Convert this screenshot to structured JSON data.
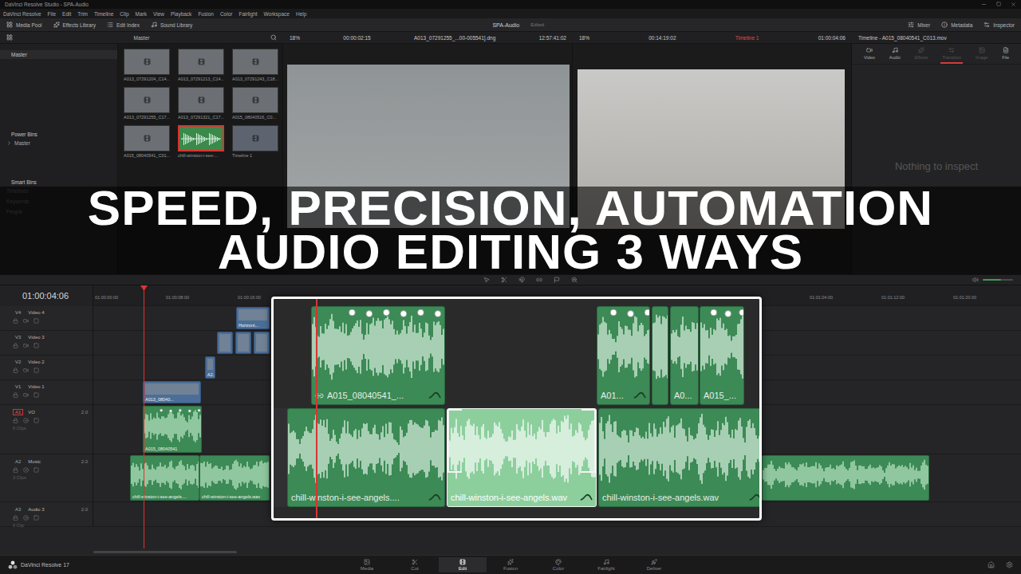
{
  "window": {
    "title": "DaVinci Resolve Studio - SPA-Audio"
  },
  "menu": [
    "DaVinci Resolve",
    "File",
    "Edit",
    "Trim",
    "Timeline",
    "Clip",
    "Mark",
    "View",
    "Playback",
    "Fusion",
    "Color",
    "Fairlight",
    "Workspace",
    "Help"
  ],
  "toolbar": {
    "left": [
      "Media Pool",
      "Effects Library",
      "Edit Index",
      "Sound Library"
    ],
    "project": "SPA-Audio",
    "status": "Edited",
    "right": [
      "Mixer",
      "Metadata",
      "Inspector"
    ]
  },
  "viewer_header": {
    "bin": "Master",
    "source_zoom": "18%",
    "source_duration": "00:00:02:15",
    "source_clip": "A013_07291255_...00-005541].dng",
    "source_timecode": "12:57:41:02",
    "timeline_zoom": "18%",
    "timeline_duration": "00:14:19:02",
    "timeline_name": "Timeline 1",
    "timeline_timecode": "01:00:04:06",
    "inspector_title": "Timeline - A015_08040541_C013.mov"
  },
  "bins": {
    "header": "Master",
    "power_bins": "Power Bins",
    "power_items": [
      {
        "label": "Master",
        "expanded": false
      }
    ],
    "smart_bins": "Smart Bins",
    "smart_items": [
      "Timelines",
      "Keywords",
      "People"
    ]
  },
  "media_pool": [
    {
      "label": "A013_07291204_C14...",
      "kind": "video",
      "selected": false
    },
    {
      "label": "A013_07291213_C14...",
      "kind": "video",
      "selected": false
    },
    {
      "label": "A013_07291243_C18...",
      "kind": "video",
      "selected": false
    },
    {
      "label": "A013_07291255_C17...",
      "kind": "video",
      "selected": false
    },
    {
      "label": "A013_07291321_C17...",
      "kind": "video",
      "selected": false
    },
    {
      "label": "A015_08040516_C0...",
      "kind": "video",
      "selected": false
    },
    {
      "label": "A015_08040541_C01...",
      "kind": "video",
      "selected": false
    },
    {
      "label": "chill-winston-i-see-...",
      "kind": "audio",
      "selected": true
    },
    {
      "label": "Timeline 1",
      "kind": "timeline",
      "selected": false
    }
  ],
  "inspector": {
    "tabs": [
      {
        "label": "Video",
        "selected": false,
        "disabled": false
      },
      {
        "label": "Audio",
        "selected": false,
        "disabled": false
      },
      {
        "label": "Effects",
        "selected": false,
        "disabled": true
      },
      {
        "label": "Transition",
        "selected": true,
        "disabled": true
      },
      {
        "label": "Image",
        "selected": false,
        "disabled": true
      },
      {
        "label": "File",
        "selected": false,
        "disabled": false
      }
    ],
    "empty": "Nothing to inspect"
  },
  "headline": [
    "SPEED, PRECISION, AUTOMATION",
    "AUDIO EDITING 3 WAYS"
  ],
  "timeline": {
    "timecode": "01:00:04:06",
    "volume_level": 0.6,
    "ruler": [
      "01:00:00:00",
      "01:00:08:00",
      "01:00:16:00",
      "01:01:04:00",
      "01:01:12:00",
      "01:01:20:00"
    ],
    "tracks": [
      {
        "id": "V4",
        "name": "Video 4",
        "kind": "video",
        "format": "",
        "count": "",
        "patched": false,
        "clips": [
          {
            "label": "Horizont...",
            "keyframes": 0
          }
        ]
      },
      {
        "id": "V3",
        "name": "Video 3",
        "kind": "video",
        "format": "",
        "count": "",
        "patched": false,
        "clips": [
          {
            "label": "",
            "keyframes": 0
          },
          {
            "label": "",
            "keyframes": 0
          },
          {
            "label": "",
            "keyframes": 0
          }
        ]
      },
      {
        "id": "V2",
        "name": "Video 2",
        "kind": "video",
        "format": "",
        "count": "",
        "patched": false,
        "clips": [
          {
            "label": "A2...",
            "keyframes": 0
          }
        ]
      },
      {
        "id": "V1",
        "name": "Video 1",
        "kind": "video",
        "format": "",
        "count": "",
        "patched": false,
        "clips": [
          {
            "label": "A013_08040...",
            "keyframes": 0
          }
        ]
      },
      {
        "id": "A1",
        "name": "VO",
        "kind": "audio",
        "format": "2.0",
        "count": "6 Clips",
        "patched": true,
        "clips": [
          {
            "label": "A015_08040541",
            "keyframes": 5
          }
        ]
      },
      {
        "id": "A2",
        "name": "Music",
        "kind": "audio",
        "format": "2.0",
        "count": "3 Clips",
        "patched": false,
        "clips": [
          {
            "label": "chill-winston-i-see-angels....",
            "keyframes": 0
          },
          {
            "label": "chill-winston-i-see-angels.wav",
            "keyframes": 0
          },
          {
            "label": "",
            "keyframes": 0
          }
        ]
      },
      {
        "id": "A3",
        "name": "Audio 3",
        "kind": "audio",
        "format": "2.0",
        "count": "0 Clip",
        "patched": false,
        "clips": []
      }
    ]
  },
  "inset": {
    "tracks": [
      {
        "name": "vo",
        "clips": [
          {
            "label": "A015_08040541_...",
            "keyframes": 6,
            "linked": true,
            "selected": false
          },
          {
            "label": "A01...",
            "keyframes": 3,
            "linked": false,
            "selected": false
          },
          {
            "label": "",
            "keyframes": 0,
            "linked": false,
            "selected": false
          },
          {
            "label": "A0...",
            "keyframes": 0,
            "linked": false,
            "selected": false
          },
          {
            "label": "A015_...",
            "keyframes": 3,
            "linked": false,
            "selected": false
          }
        ]
      },
      {
        "name": "music",
        "clips": [
          {
            "label": "chill-winston-i-see-angels....",
            "keyframes": 0,
            "linked": false,
            "selected": false
          },
          {
            "label": "chill-winston-i-see-angels.wav",
            "keyframes": 0,
            "linked": false,
            "selected": true
          },
          {
            "label": "chill-winston-i-see-angels.wav",
            "keyframes": 0,
            "linked": false,
            "selected": false
          }
        ]
      }
    ]
  },
  "pages": [
    {
      "label": "Media",
      "selected": false
    },
    {
      "label": "Cut",
      "selected": false
    },
    {
      "label": "Edit",
      "selected": true
    },
    {
      "label": "Fusion",
      "selected": false
    },
    {
      "label": "Color",
      "selected": false
    },
    {
      "label": "Fairlight",
      "selected": false
    },
    {
      "label": "Deliver",
      "selected": false
    }
  ],
  "app": "DaVinci Resolve 17"
}
